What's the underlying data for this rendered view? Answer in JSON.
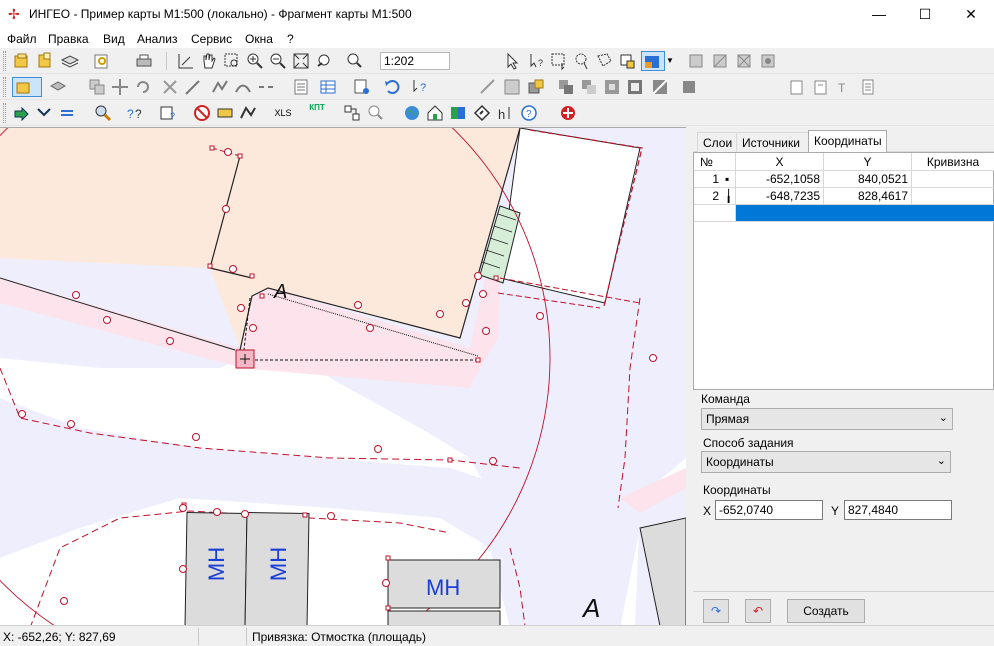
{
  "window": {
    "title": "ИНГЕО - Пример карты М1:500 (локально) - Фрагмент карты М1:500",
    "minimize": "—",
    "maximize": "☐",
    "close": "✕"
  },
  "menu": [
    "Файл",
    "Правка",
    "Вид",
    "Анализ",
    "Сервис",
    "Окна",
    "?"
  ],
  "toolbar": {
    "zoom_value": "1:202",
    "xls_label": "XLS",
    "kpt_label": "КПТ"
  },
  "map": {
    "letter_a_top": "A",
    "letter_a_bottom": "A",
    "building_label": "МН",
    "building_label_2": "МН",
    "building_label_3": "МН"
  },
  "panel": {
    "tabs": [
      "Слои",
      "Источники",
      "Координаты"
    ],
    "columns": [
      "№",
      "X",
      "Y",
      "Кривизна"
    ],
    "rows": [
      {
        "n": "1",
        "x": "-652,1058",
        "y": "840,0521",
        "curve": ""
      },
      {
        "n": "2",
        "x": "-648,7235",
        "y": "828,4617",
        "curve": ""
      }
    ],
    "command_label": "Команда",
    "command_value": "Прямая",
    "method_label": "Способ задания",
    "method_value": "Координаты",
    "coords_label": "Координаты",
    "x_label": "X",
    "x_value": "-652,0740",
    "y_label": "Y",
    "y_value": "827,4840",
    "create_button": "Создать"
  },
  "status": {
    "coords": "X: -652,26; Y: 827,69",
    "snap": "Привязка: Отмостка (площадь)"
  },
  "colors": {
    "accent_selection": "#0078d7",
    "map_road": "#eeeefc",
    "map_pink": "#fde3ec",
    "map_parcel": "#fde9dc",
    "map_line_red": "#c0112a",
    "building_gray": "#dcdcdc",
    "label_blue": "#1a3fd6"
  }
}
